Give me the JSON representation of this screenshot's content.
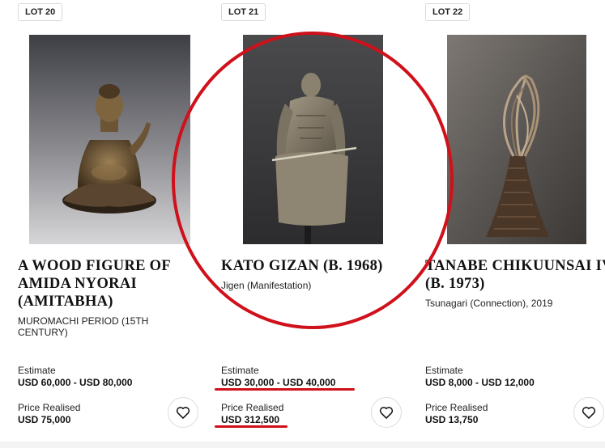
{
  "lots": [
    {
      "badge": "LOT 20",
      "title": "A WOOD FIGURE OF\nAMIDA NYORAI\n(AMITABHA)",
      "subtitle": "MUROMACHI PERIOD (15TH\nCENTURY)",
      "estimate_label": "Estimate",
      "estimate": "USD 60,000 - USD 80,000",
      "realised_label": "Price Realised",
      "realised": "USD 75,000",
      "image_icon": "buddha-statue-image"
    },
    {
      "badge": "LOT 21",
      "title": "KATO GIZAN (B. 1968)",
      "subtitle": "Jigen (Manifestation)",
      "estimate_label": "Estimate",
      "estimate": "USD 30,000 - USD 40,000",
      "realised_label": "Price Realised",
      "realised": "USD 312,500",
      "image_icon": "seated-figure-sculpture-image"
    },
    {
      "badge": "LOT 22",
      "title": "TANABE CHIKUUNSAI IV\n(B. 1973)",
      "subtitle": "Tsunagari (Connection), 2019",
      "estimate_label": "Estimate",
      "estimate": "USD 8,000 - USD 12,000",
      "realised_label": "Price Realised",
      "realised": "USD 13,750",
      "image_icon": "bamboo-basket-image"
    }
  ],
  "annotation_color": "#d0101a"
}
